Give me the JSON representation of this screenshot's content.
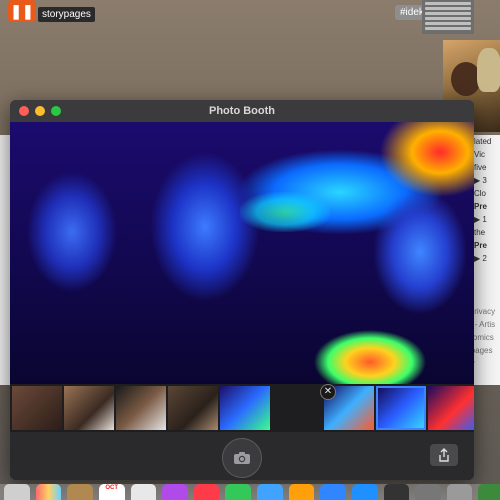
{
  "desktop": {
    "app_badge_glyph": "❚❚",
    "storypages_label": "storypages",
    "hashtag_label": "#idek"
  },
  "bg_panel": {
    "items": [
      {
        "text": "lated",
        "bold": false
      },
      {
        "text": "Vic",
        "bold": false
      },
      {
        "text": "five",
        "bold": false
      },
      {
        "text": "▶ 3",
        "bold": false
      },
      {
        "text": "Clo",
        "bold": false
      },
      {
        "text": "Pre",
        "bold": true
      },
      {
        "text": "▶ 1",
        "bold": false
      },
      {
        "text": "the",
        "bold": false
      },
      {
        "text": "Pre",
        "bold": true
      },
      {
        "text": "▶ 2",
        "bold": false
      }
    ],
    "footer_lines": [
      "- Privacy",
      "ay - Artis",
      "onomics",
      "rypages",
      "ver"
    ]
  },
  "window": {
    "title": "Photo Booth",
    "strip_close_glyph": "✕"
  },
  "colors": {
    "accent_selected": "#3f84ff",
    "window_bg": "#2c2c2e",
    "close_light": "#ff5f57",
    "minimize_light": "#febc2e",
    "zoom_light": "#28c840"
  },
  "dock": {
    "calendar_month": "OCT"
  },
  "icons": [
    "camera-icon",
    "share-icon",
    "close-icon"
  ]
}
